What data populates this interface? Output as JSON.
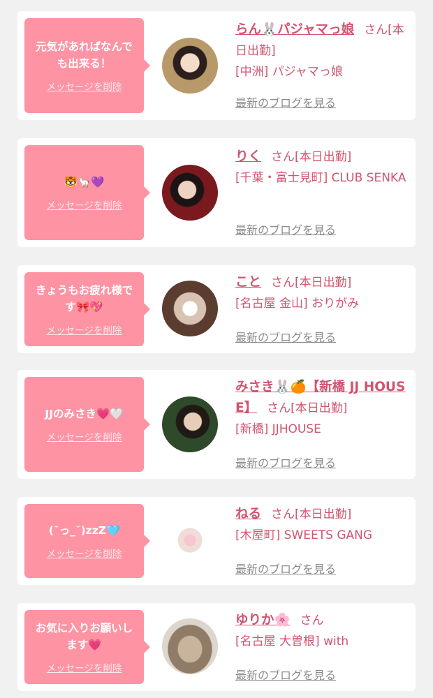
{
  "delete_label": "メッセージを削除",
  "blog_label": "最新のブログを見る",
  "entries": [
    {
      "message": "元気があればなんでも出来る！",
      "name": "らん🐰パジャマっ娘",
      "san": "さん",
      "status": "[本日出勤]",
      "shop": "[中洲] パジャマっ娘"
    },
    {
      "message": "🐯🦙💜",
      "name": "りく",
      "san": "さん",
      "status": "[本日出勤]",
      "shop": "[千葉・富士見町] CLUB SENKA"
    },
    {
      "message": "きょうもお疲れ様です🎀💖",
      "name": "こと",
      "san": "さん",
      "status": "[本日出勤]",
      "shop": "[名古屋 金山] おりがみ"
    },
    {
      "message": "JJのみさき💗🤍",
      "name": "みさき🐰🍊【新橋 JJ HOUSE】",
      "san": "さん",
      "status": "[本日出勤]",
      "shop": "[新橋] JJHOUSE"
    },
    {
      "message": "(˘っ_˘)zzZ🩵",
      "name": "ねる",
      "san": "さん",
      "status": "[本日出勤]",
      "shop": "[木屋町] SWEETS GANG"
    },
    {
      "message": "お気に入りお願いします💗",
      "name": "ゆりか🌸",
      "san": "さん",
      "status": "",
      "shop": "[名古屋 大曽根] with"
    }
  ]
}
